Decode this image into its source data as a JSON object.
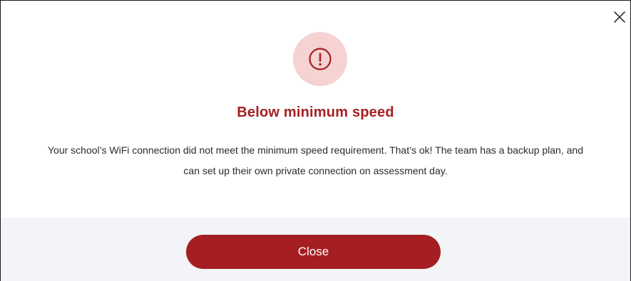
{
  "dialog": {
    "title": "Below minimum speed",
    "message": "Your school’s WiFi connection did not meet the minimum speed requirement. That’s ok! The team has a backup plan, and can set up their own private connection on assessment day.",
    "close_button_label": "Close",
    "icons": {
      "dismiss": "close-icon",
      "alert": "alert-circle-icon"
    }
  },
  "colors": {
    "accent": "#a51f22",
    "icon_background": "#f6d2d2",
    "footer_background": "#f2f4f7",
    "text": "#2b2b2b"
  }
}
